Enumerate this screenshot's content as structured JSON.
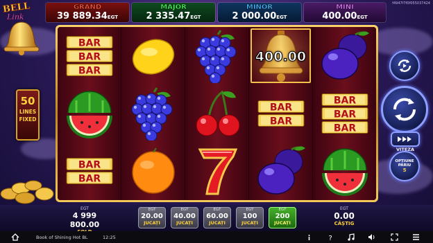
{
  "game_id": "f4947f7f0f055037424",
  "logo": {
    "line1": "BELL",
    "line2": "Link"
  },
  "jackpots": [
    {
      "name": "GRAND",
      "value": "39 889.34",
      "unit": "EGT"
    },
    {
      "name": "MAJOR",
      "value": "2 335.47",
      "unit": "EGT"
    },
    {
      "name": "MINOR",
      "value": "2 000.00",
      "unit": "EGT"
    },
    {
      "name": "MINI",
      "value": "400.00",
      "unit": "EGT"
    }
  ],
  "lines_badge": {
    "count": "50",
    "line2": "LINES",
    "line3": "FIXED"
  },
  "reels": [
    [
      "bar-triple",
      "watermelon",
      "bar-double"
    ],
    [
      "lemon",
      "grapes",
      "orange"
    ],
    [
      "grapes",
      "cherries",
      "seven"
    ],
    [
      "bell",
      "bar-double",
      "plum"
    ],
    [
      "plum",
      "bar-triple",
      "watermelon"
    ]
  ],
  "bar_text": "BAR",
  "bell_win_value": "400.00",
  "controls": {
    "speed_label": "VITEZA",
    "options_label_1": "OPȚIUNE",
    "options_label_2": "PARIU",
    "options_value": "5"
  },
  "credit": {
    "caption": "EGT",
    "value": "4 999 800.00",
    "label": "SOLD"
  },
  "bets": [
    {
      "caption": "EGT",
      "value": "20.00",
      "label": "JUCAȚI",
      "selected": false
    },
    {
      "caption": "EGT",
      "value": "40.00",
      "label": "JUCAȚI",
      "selected": false
    },
    {
      "caption": "EGT",
      "value": "60.00",
      "label": "JUCAȚI",
      "selected": false
    },
    {
      "caption": "EGT",
      "value": "100",
      "label": "JUCAȚI",
      "selected": false
    },
    {
      "caption": "EGT",
      "value": "200",
      "label": "JUCAȚI",
      "selected": true
    }
  ],
  "win": {
    "caption": "EGT",
    "value": "0.00",
    "label": "CÂȘTIG"
  },
  "system_bar": {
    "app_name": "Book of Shining Hot BL",
    "time": "12:25"
  },
  "colors": {
    "frame_gold": "#f8d36a",
    "reel_bg": "#4d0710",
    "selected_bet": "#46b02a"
  }
}
